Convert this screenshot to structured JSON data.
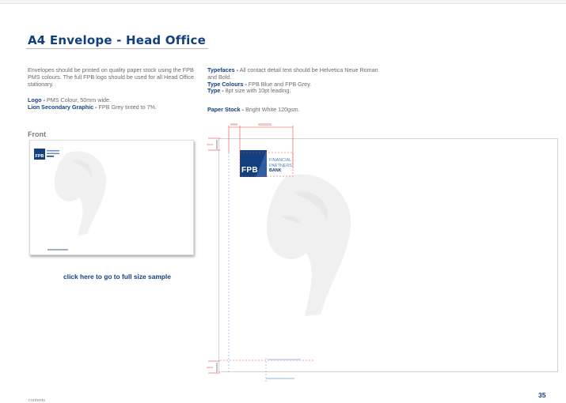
{
  "title": "A4 Envelope - Head Office",
  "intro": "Envelopes should be printed on quality paper stock using the FPB PMS colours. The full FPB logo should be used for all Head Office stationary.",
  "specs_left": [
    {
      "label": "Logo -",
      "value": "PMS Colour, 50mm wide."
    },
    {
      "label": "Lion Secondary Graphic -",
      "value": "FPB Grey tinted to 7%."
    }
  ],
  "specs_right": [
    {
      "label": "Typefaces -",
      "value": "All contact detail text should be Helvetica Neue Roman and Bold."
    },
    {
      "label": "Type Colours -",
      "value": "FPB Blue and FPB Grey."
    },
    {
      "label": "Type -",
      "value": "8pt size with 10pt leading."
    }
  ],
  "paper": {
    "label": "Paper Stock -",
    "value": "Bright White 120gsm."
  },
  "front_label": "Front",
  "fullsize_link": "click here to go to full size sample",
  "logo": {
    "mark": "FPB",
    "line1": "FINANCIAL",
    "line2": "PARTNERS",
    "line3": "BANK"
  },
  "page_number": "35",
  "contents_link": "contents",
  "colors": {
    "brand_blue": "#12407f",
    "guide_red": "#e64646",
    "guide_blue": "#5a8fd0"
  }
}
